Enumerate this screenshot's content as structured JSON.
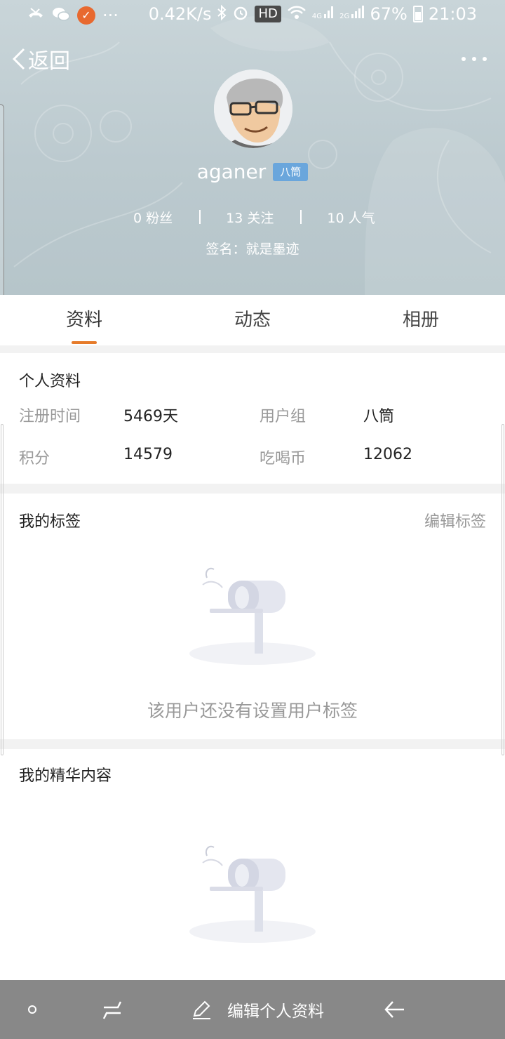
{
  "status_bar": {
    "net_speed": "0.42K/s",
    "hd": "HD",
    "battery": "67%",
    "time": "21:03",
    "more": "···",
    "signal_4g": "4G",
    "signal_2g": "2G"
  },
  "header": {
    "back_label": "返回",
    "username": "aganer",
    "level": "八筒",
    "stats": {
      "fans": "0 粉丝",
      "following": "13 关注",
      "popularity": "10 人气"
    },
    "signature": "签名：就是墨迹"
  },
  "tabs": [
    {
      "label": "资料"
    },
    {
      "label": "动态"
    },
    {
      "label": "相册"
    }
  ],
  "profile": {
    "title": "个人资料",
    "register_label": "注册时间",
    "register_value": "5469天",
    "group_label": "用户组",
    "group_value": "八筒",
    "points_label": "积分",
    "points_value": "14579",
    "coins_label": "吃喝币",
    "coins_value": "12062"
  },
  "tags": {
    "title": "我的标签",
    "edit_label": "编辑标签",
    "empty_text": "该用户还没有设置用户标签"
  },
  "featured": {
    "title": "我的精华内容"
  },
  "bottom_bar": {
    "edit_profile_label": "编辑个人资料"
  },
  "colors": {
    "accent": "#e67b2a",
    "badge": "#6aa6dc",
    "header_bg": "#bccacf",
    "bottom_bar": "#888888"
  }
}
